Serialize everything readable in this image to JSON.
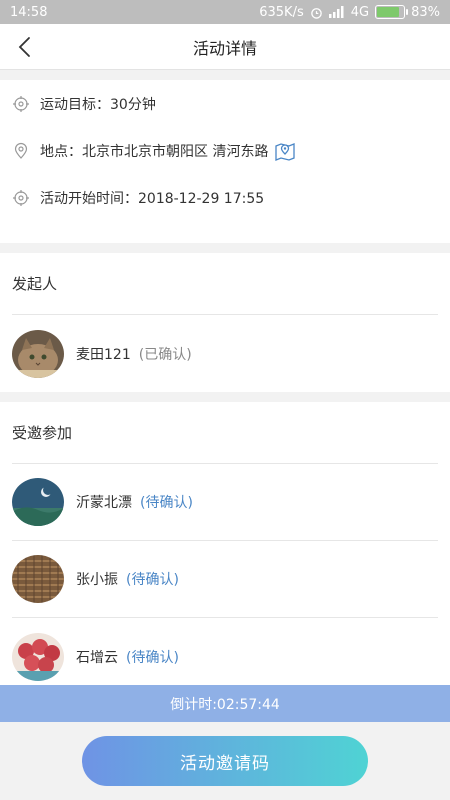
{
  "status_bar": {
    "time": "14:58",
    "net_speed": "635K/s",
    "network": "4G",
    "battery": "83%"
  },
  "nav": {
    "title": "活动详情",
    "back_icon": "chevron-left-icon"
  },
  "info": {
    "goal": "运动目标：30分钟",
    "location": "地点：北京市北京市朝阳区 清河东路",
    "start_time": "活动开始时间：2018-12-29 17:55"
  },
  "initiator": {
    "title": "发起人",
    "people": [
      {
        "name": "麦田121",
        "status": "(已确认)"
      }
    ]
  },
  "invited": {
    "title": "受邀参加",
    "people": [
      {
        "name": "沂蒙北漂",
        "status": "(待确认)"
      },
      {
        "name": "张小振",
        "status": "(待确认)"
      },
      {
        "name": "石增云",
        "status": "(待确认)"
      }
    ]
  },
  "countdown": "倒计时:02:57:44",
  "invite_button": "活动邀请码",
  "colors": {
    "accent_start": "#6f93e5",
    "accent_end": "#4fd3d4",
    "countdown_bg": "#8fb0e6",
    "pending": "#4a86c6"
  }
}
